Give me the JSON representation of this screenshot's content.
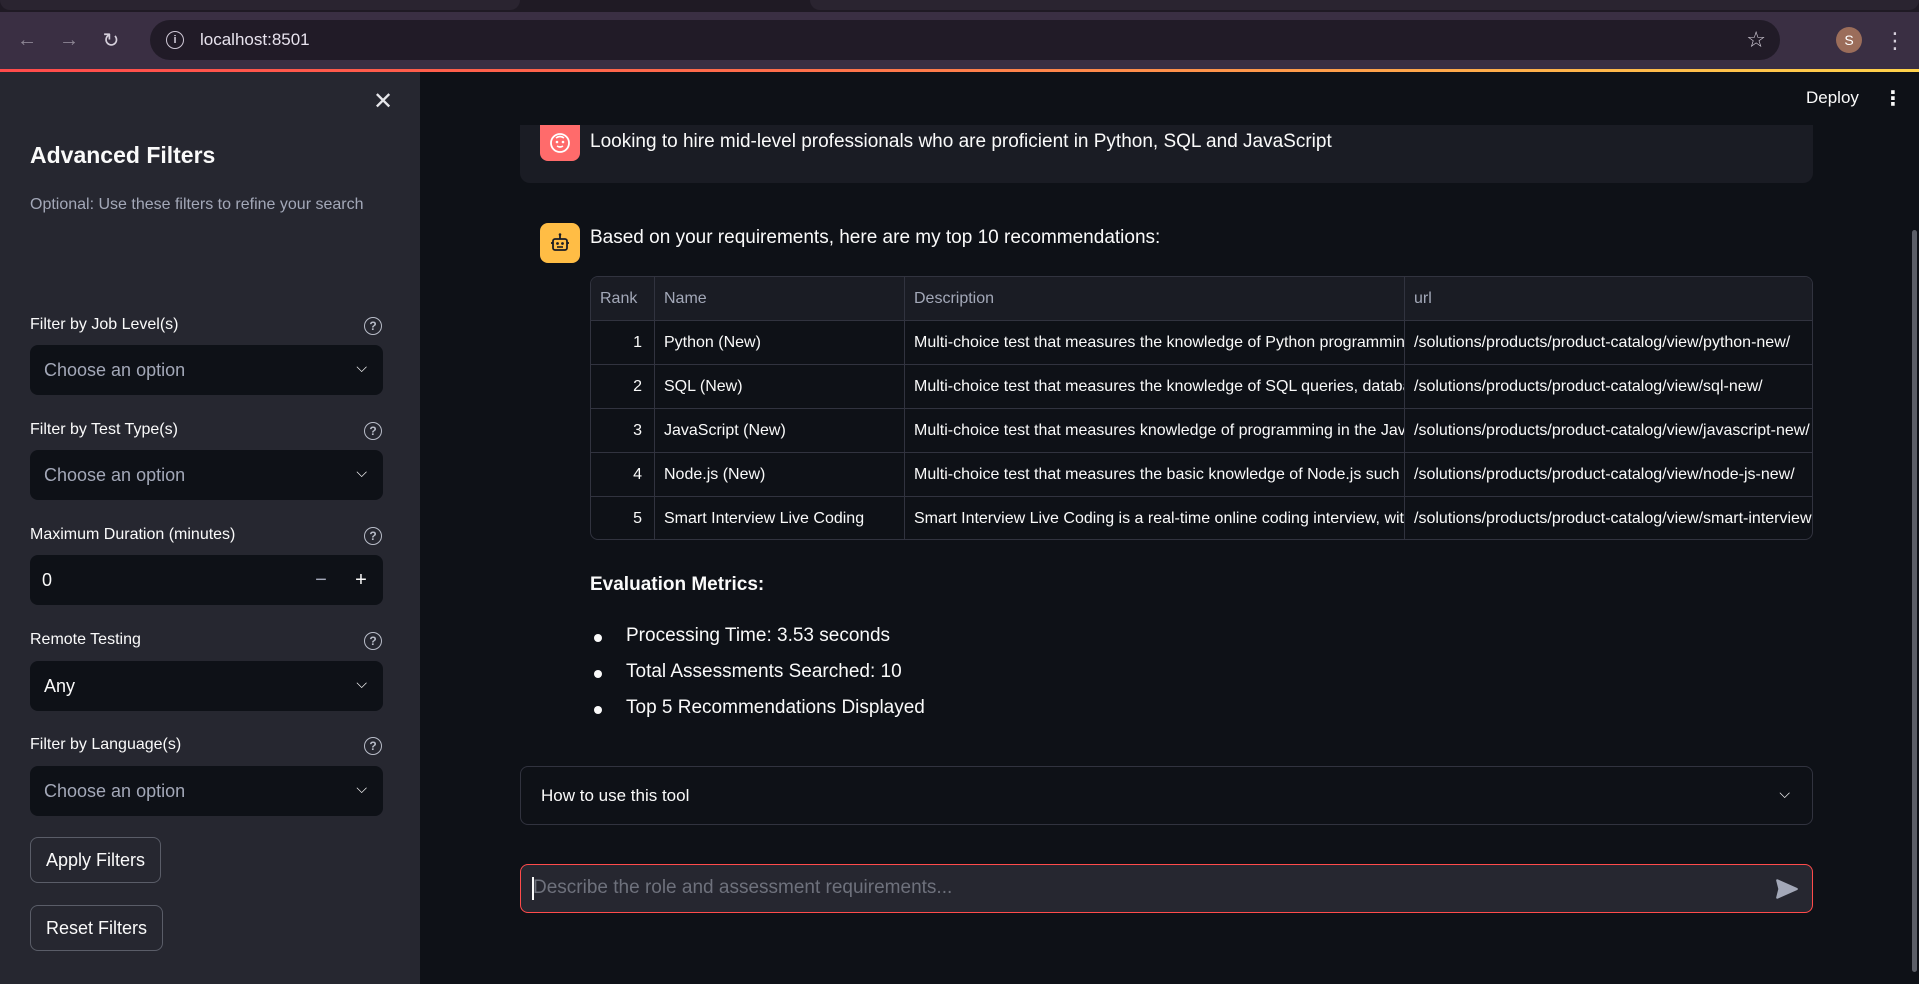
{
  "browser": {
    "url": "localhost:8501",
    "profile_initial": "S"
  },
  "sidebar": {
    "title": "Advanced Filters",
    "caption": "Optional: Use these filters to refine your search",
    "job_level": {
      "label": "Filter by Job Level(s)",
      "placeholder": "Choose an option"
    },
    "test_type": {
      "label": "Filter by Test Type(s)",
      "placeholder": "Choose an option"
    },
    "duration": {
      "label": "Maximum Duration (minutes)",
      "value": "0"
    },
    "remote": {
      "label": "Remote Testing",
      "value": "Any"
    },
    "language": {
      "label": "Filter by Language(s)",
      "placeholder": "Choose an option"
    },
    "apply_label": "Apply Filters",
    "reset_label": "Reset Filters"
  },
  "header": {
    "deploy_label": "Deploy"
  },
  "chat": {
    "user_message": "Looking to hire mid-level professionals who are proficient in Python, SQL and JavaScript",
    "assistant_message": "Based on your requirements, here are my top 10 recommendations:",
    "table": {
      "columns": [
        "Rank",
        "Name",
        "Description",
        "url"
      ],
      "rows": [
        {
          "rank": "1",
          "name": "Python (New)",
          "description": "Multi-choice test that measures the knowledge of Python programming",
          "url": "/solutions/products/product-catalog/view/python-new/"
        },
        {
          "rank": "2",
          "name": "SQL (New)",
          "description": "Multi-choice test that measures the knowledge of SQL queries, databases",
          "url": "/solutions/products/product-catalog/view/sql-new/"
        },
        {
          "rank": "3",
          "name": "JavaScript (New)",
          "description": "Multi-choice test that measures knowledge of programming in the JavaScript",
          "url": "/solutions/products/product-catalog/view/javascript-new/"
        },
        {
          "rank": "4",
          "name": "Node.js (New)",
          "description": "Multi-choice test that measures the basic knowledge of Node.js such",
          "url": "/solutions/products/product-catalog/view/node-js-new/"
        },
        {
          "rank": "5",
          "name": "Smart Interview Live Coding",
          "description": "Smart Interview Live Coding is a real-time online coding interview, with",
          "url": "/solutions/products/product-catalog/view/smart-interview-live-coding/"
        }
      ]
    },
    "metrics_title": "Evaluation Metrics:",
    "metrics": [
      "Processing Time: 3.53 seconds",
      "Total Assessments Searched: 10",
      "Top 5 Recommendations Displayed"
    ],
    "expander_label": "How to use this tool",
    "input_placeholder": "Describe the role and assessment requirements..."
  },
  "colors": {
    "primary": "#ff4b4b",
    "user_avatar": "#ff6b6b",
    "bot_avatar": "#ffbd45",
    "sidebar_bg": "#262730",
    "main_bg": "#0e1117"
  }
}
